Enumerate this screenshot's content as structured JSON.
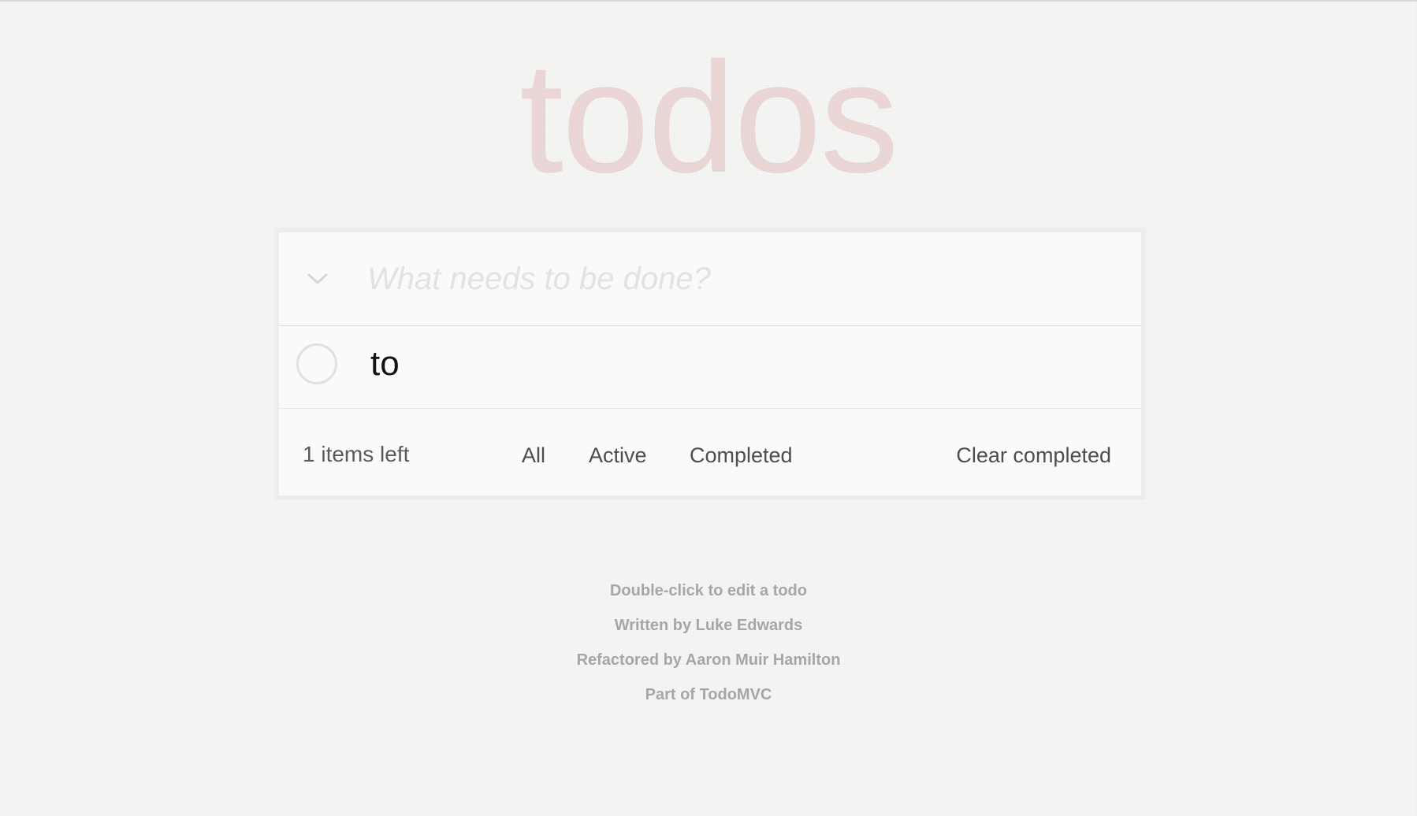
{
  "app": {
    "title": "todos"
  },
  "new_todo": {
    "placeholder": "What needs to be done?",
    "value": ""
  },
  "toggle_all": {
    "icon": "chevron-down-icon"
  },
  "todos": [
    {
      "label": "to",
      "completed": false
    }
  ],
  "footer": {
    "count_text": "1 items left",
    "filters": [
      {
        "label": "All",
        "selected": true
      },
      {
        "label": "Active",
        "selected": false
      },
      {
        "label": "Completed",
        "selected": false
      }
    ],
    "clear_label": "Clear completed"
  },
  "info": {
    "hint": "Double-click to edit a todo",
    "written_by": "Written by Luke Edwards",
    "refactored_by": "Refactored by Aaron Muir Hamilton",
    "part_of": "Part of TodoMVC"
  },
  "colors": {
    "title": "#af2f2f",
    "background": "#f5f5f4",
    "panel": "#fafafa"
  }
}
